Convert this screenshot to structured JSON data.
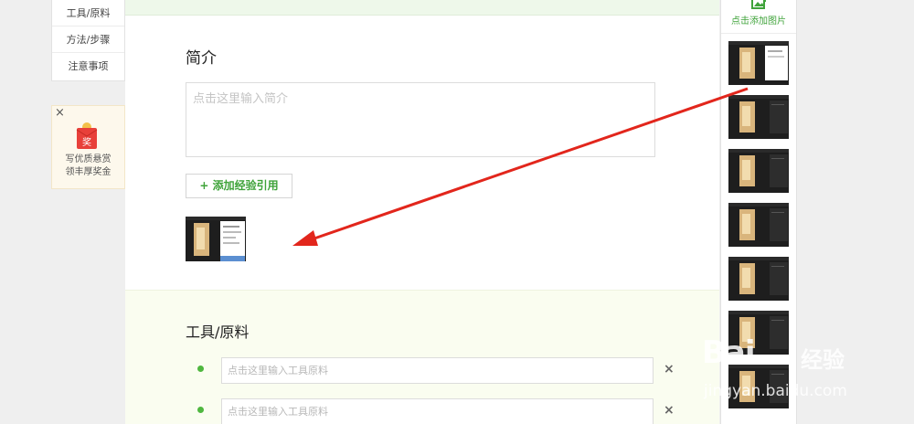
{
  "left_nav": {
    "items": [
      {
        "label": "工具/原料"
      },
      {
        "label": "方法/步骤"
      },
      {
        "label": "注意事项"
      }
    ]
  },
  "reward": {
    "close": "×",
    "badge": "奖",
    "line1": "写优质悬赏",
    "line2": "领丰厚奖金"
  },
  "intro": {
    "title": "简介",
    "placeholder": "点击这里输入简介",
    "add_ref_label": "+ 添加经验引用"
  },
  "tools": {
    "title": "工具/原料",
    "fields": [
      {
        "placeholder": "点击这里输入工具原料",
        "remove": "×"
      },
      {
        "placeholder": "点击这里输入工具原料",
        "remove": "×"
      }
    ]
  },
  "right_panel": {
    "add_image_label": "点击添加图片"
  },
  "watermark": {
    "brand": "Bai",
    "brand_cn": "经验",
    "url": "jingyan.baidu.com"
  },
  "colors": {
    "accent_green": "#3fa33a",
    "arrow_red": "#e2261c"
  }
}
